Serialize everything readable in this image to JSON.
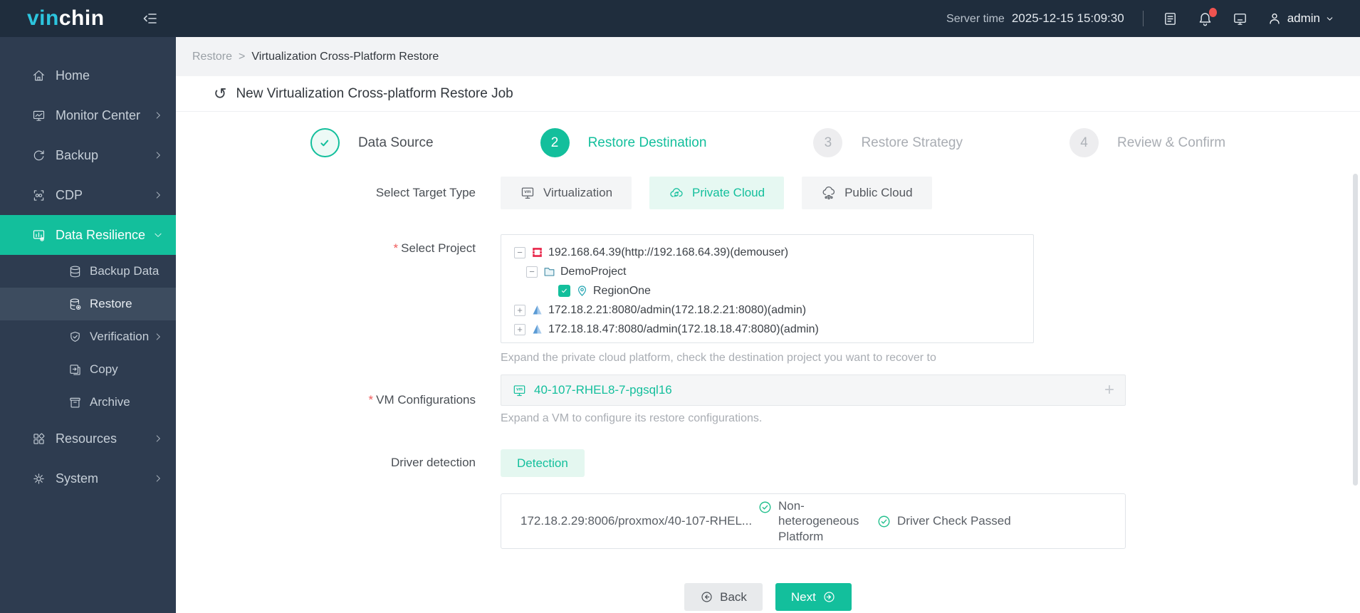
{
  "colors": {
    "accent": "#13bf9c",
    "header_bg": "#1f2d3d",
    "sidebar_bg": "#2e3c50",
    "logo_cyan": "#2cc5de",
    "notification_dot": "#ef5350",
    "openstack_red": "#e8274b",
    "platform_blue": "#5b9bd5",
    "required_red": "#f05b5b",
    "pending_gray": "#ededef"
  },
  "icons": {
    "restore_title_glyph": "↺",
    "minus": "−",
    "plus": "+"
  },
  "header": {
    "logo_primary": "vin",
    "logo_secondary": "chin",
    "server_time_label": "Server time",
    "server_time_value": "2025-12-15 15:09:30",
    "username": "admin"
  },
  "sidebar": {
    "items": [
      {
        "label": "Home"
      },
      {
        "label": "Monitor Center"
      },
      {
        "label": "Backup"
      },
      {
        "label": "CDP"
      },
      {
        "label": "Data Resilience"
      },
      {
        "label": "Backup Data"
      },
      {
        "label": "Restore"
      },
      {
        "label": "Verification"
      },
      {
        "label": "Copy"
      },
      {
        "label": "Archive"
      },
      {
        "label": "Resources"
      },
      {
        "label": "System"
      }
    ]
  },
  "breadcrumb": {
    "parent": "Restore",
    "separator": ">",
    "current": "Virtualization Cross-Platform Restore"
  },
  "page_title": "New Virtualization Cross-platform Restore Job",
  "stepper": {
    "steps": [
      {
        "number": "1",
        "label": "Data Source",
        "state": "done"
      },
      {
        "number": "2",
        "label": "Restore Destination",
        "state": "active"
      },
      {
        "number": "3",
        "label": "Restore Strategy",
        "state": "pending"
      },
      {
        "number": "4",
        "label": "Review & Confirm",
        "state": "pending"
      }
    ]
  },
  "form": {
    "required_mark": "*",
    "target_type": {
      "label": "Select Target Type",
      "options": [
        {
          "label": "Virtualization",
          "selected": false
        },
        {
          "label": "Private Cloud",
          "selected": true
        },
        {
          "label": "Public Cloud",
          "selected": false
        }
      ]
    },
    "select_project": {
      "label": "Select Project",
      "tree": [
        {
          "sym": "−",
          "text": "192.168.64.39(http://192.168.64.39)(demouser)",
          "icon": "openstack",
          "level": 0
        },
        {
          "sym": "−",
          "text": "DemoProject",
          "icon": "folder",
          "level": 1
        },
        {
          "sym": "",
          "text": "RegionOne",
          "icon": "location-pin",
          "level": 2,
          "checked": true
        },
        {
          "sym": "+",
          "text": "172.18.2.21:8080/admin(172.18.2.21:8080)(admin)",
          "icon": "platform-triangle",
          "level": 0
        },
        {
          "sym": "+",
          "text": "172.18.18.47:8080/admin(172.18.18.47:8080)(admin)",
          "icon": "platform-triangle",
          "level": 0
        }
      ],
      "hint": "Expand the private cloud platform, check the destination project you want to recover to"
    },
    "vm_configurations": {
      "label": "VM Configurations",
      "value": "40-107-RHEL8-7-pgsql16",
      "add_symbol": "+",
      "hint": "Expand a VM to configure its restore configurations."
    },
    "driver_detection": {
      "label": "Driver detection",
      "button_label": "Detection",
      "result": {
        "target": "172.18.2.29:8006/proxmox/40-107-RHEL...",
        "check1": "Non-heterogeneous Platform",
        "check2": "Driver Check Passed"
      }
    }
  },
  "footer": {
    "back_label": "Back",
    "next_label": "Next"
  }
}
